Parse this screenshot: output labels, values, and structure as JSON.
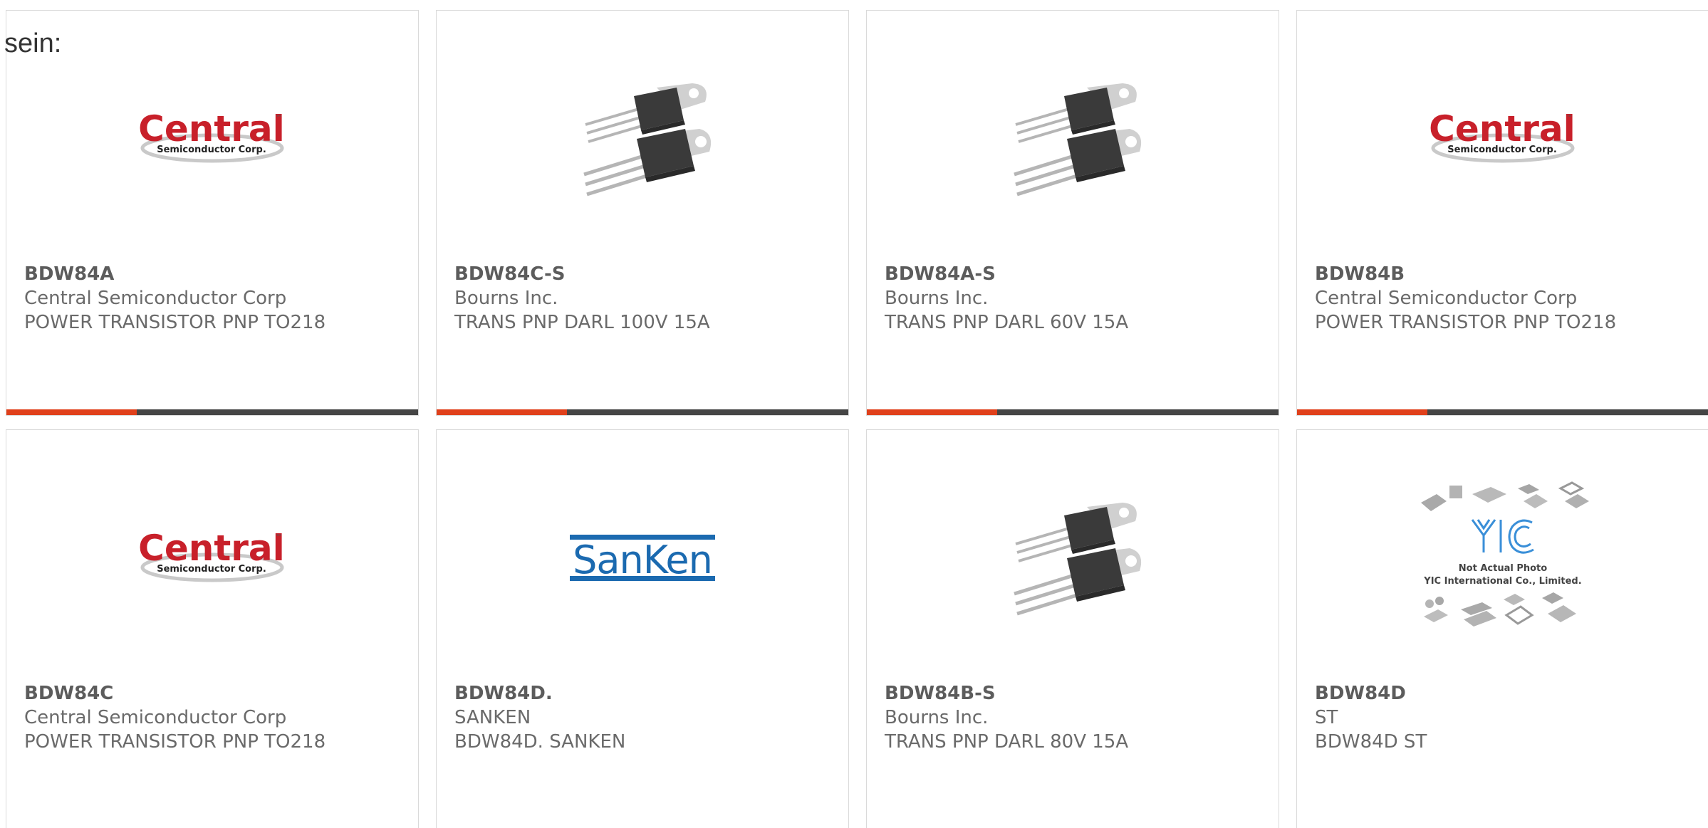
{
  "lead_text": "sein:",
  "colors": {
    "accent_bar": "#e0401b",
    "dark_bar": "#454545",
    "central_red": "#c8202a",
    "sanken_blue": "#1b6ab0",
    "yic_blue": "#3a8fd8"
  },
  "cards": [
    {
      "part_number": "BDW84A",
      "manufacturer": "Central Semiconductor Corp",
      "description": "POWER TRANSISTOR PNP TO218",
      "image": "central-logo"
    },
    {
      "part_number": "BDW84C-S",
      "manufacturer": "Bourns Inc.",
      "description": "TRANS PNP DARL 100V 15A",
      "image": "transistor-photo"
    },
    {
      "part_number": "BDW84A-S",
      "manufacturer": "Bourns Inc.",
      "description": "TRANS PNP DARL 60V 15A",
      "image": "transistor-photo"
    },
    {
      "part_number": "BDW84B",
      "manufacturer": "Central Semiconductor Corp",
      "description": "POWER TRANSISTOR PNP TO218",
      "image": "central-logo"
    },
    {
      "part_number": "BDW84C",
      "manufacturer": "Central Semiconductor Corp",
      "description": "POWER TRANSISTOR PNP TO218",
      "image": "central-logo"
    },
    {
      "part_number": "BDW84D.",
      "manufacturer": "SANKEN",
      "description": "BDW84D. SANKEN",
      "image": "sanken-logo"
    },
    {
      "part_number": "BDW84B-S",
      "manufacturer": "Bourns Inc.",
      "description": "TRANS PNP DARL 80V 15A",
      "image": "transistor-photo"
    },
    {
      "part_number": "BDW84D",
      "manufacturer": "ST",
      "description": "BDW84D ST",
      "image": "yic-placeholder"
    }
  ],
  "logos": {
    "central_word": "Central",
    "central_sub": "Semiconductor Corp.",
    "central_tm": "™",
    "sanken_word": "SanKen",
    "yic_word": "YIC",
    "yic_line1": "Not Actual Photo",
    "yic_line2": "YIC International Co., Limited."
  }
}
